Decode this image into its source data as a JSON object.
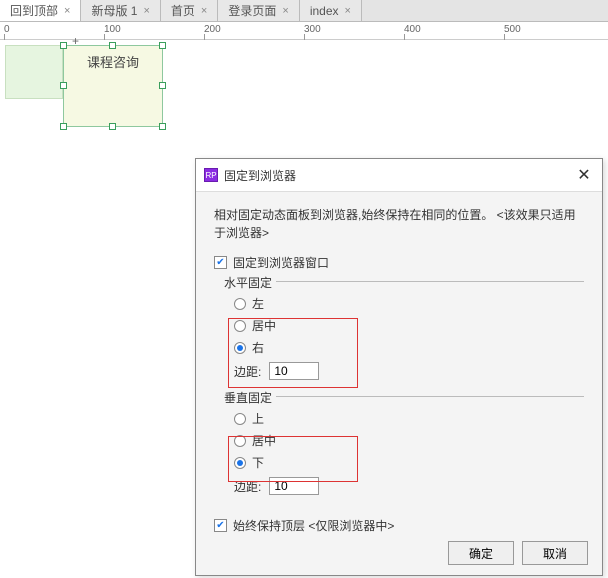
{
  "tabs": [
    {
      "label": "回到顶部",
      "active": true
    },
    {
      "label": "新母版 1",
      "active": false
    },
    {
      "label": "首页",
      "active": false
    },
    {
      "label": "登录页面",
      "active": false
    },
    {
      "label": "index",
      "active": false
    }
  ],
  "ruler": [
    "0",
    "100",
    "200",
    "300",
    "400",
    "500"
  ],
  "shape": {
    "label": "课程咨询"
  },
  "dialog": {
    "title": "固定到浏览器",
    "desc": "相对固定动态面板到浏览器,始终保持在相同的位置。 <该效果只适用于浏览器>",
    "pin_checkbox": "固定到浏览器窗口",
    "h_group": "水平固定",
    "h_left": "左",
    "h_center": "居中",
    "h_right": "右",
    "margin_label": "边距:",
    "h_margin": "10",
    "v_group": "垂直固定",
    "v_top": "上",
    "v_center": "居中",
    "v_bottom": "下",
    "v_margin": "10",
    "keep_top": "始终保持顶层 <仅限浏览器中>",
    "ok": "确定",
    "cancel": "取消"
  }
}
